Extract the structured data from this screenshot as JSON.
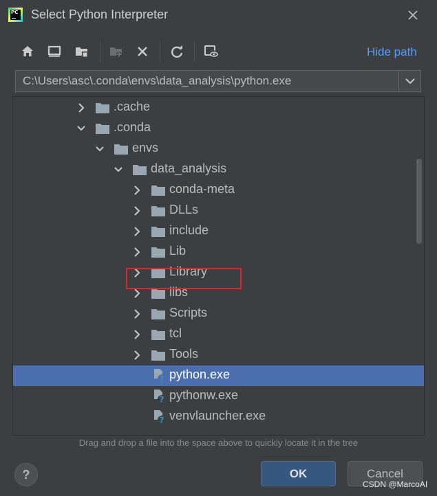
{
  "window": {
    "title": "Select Python Interpreter"
  },
  "toolbar": {
    "icons": [
      "home-icon",
      "desktop-icon",
      "project-folder-icon",
      "new-folder-icon",
      "delete-icon",
      "refresh-icon",
      "show-hidden-icon"
    ],
    "hide_path_label": "Hide path"
  },
  "path": {
    "value": "C:\\Users\\asc\\.conda\\envs\\data_analysis\\python.exe"
  },
  "tree": {
    "items": [
      {
        "label": ".cache",
        "type": "folder",
        "expanded": false,
        "depth": 0
      },
      {
        "label": ".conda",
        "type": "folder",
        "expanded": true,
        "depth": 0
      },
      {
        "label": "envs",
        "type": "folder",
        "expanded": true,
        "depth": 1
      },
      {
        "label": "data_analysis",
        "type": "folder",
        "expanded": true,
        "depth": 2
      },
      {
        "label": "conda-meta",
        "type": "folder",
        "expanded": false,
        "depth": 3
      },
      {
        "label": "DLLs",
        "type": "folder",
        "expanded": false,
        "depth": 3
      },
      {
        "label": "include",
        "type": "folder",
        "expanded": false,
        "depth": 3
      },
      {
        "label": "Lib",
        "type": "folder",
        "expanded": false,
        "depth": 3
      },
      {
        "label": "Library",
        "type": "folder",
        "expanded": false,
        "depth": 3
      },
      {
        "label": "libs",
        "type": "folder",
        "expanded": false,
        "depth": 3
      },
      {
        "label": "Scripts",
        "type": "folder",
        "expanded": false,
        "depth": 3
      },
      {
        "label": "tcl",
        "type": "folder",
        "expanded": false,
        "depth": 3
      },
      {
        "label": "Tools",
        "type": "folder",
        "expanded": false,
        "depth": 3
      },
      {
        "label": "python.exe",
        "type": "file",
        "depth": 3,
        "selected": true
      },
      {
        "label": "pythonw.exe",
        "type": "file",
        "depth": 3
      },
      {
        "label": "venvlauncher.exe",
        "type": "file",
        "depth": 3
      }
    ]
  },
  "hint": "Drag and drop a file into the space above to quickly locate it in the tree",
  "buttons": {
    "help": "?",
    "ok": "OK",
    "cancel": "Cancel"
  },
  "watermark": "CSDN @MarcoAI",
  "colors": {
    "background": "#3c3f41",
    "selection": "#4b6eaf",
    "link": "#589df6",
    "folder": "#9aa7b0",
    "highlight_box": "#e0242a",
    "ok_button": "#365880"
  }
}
